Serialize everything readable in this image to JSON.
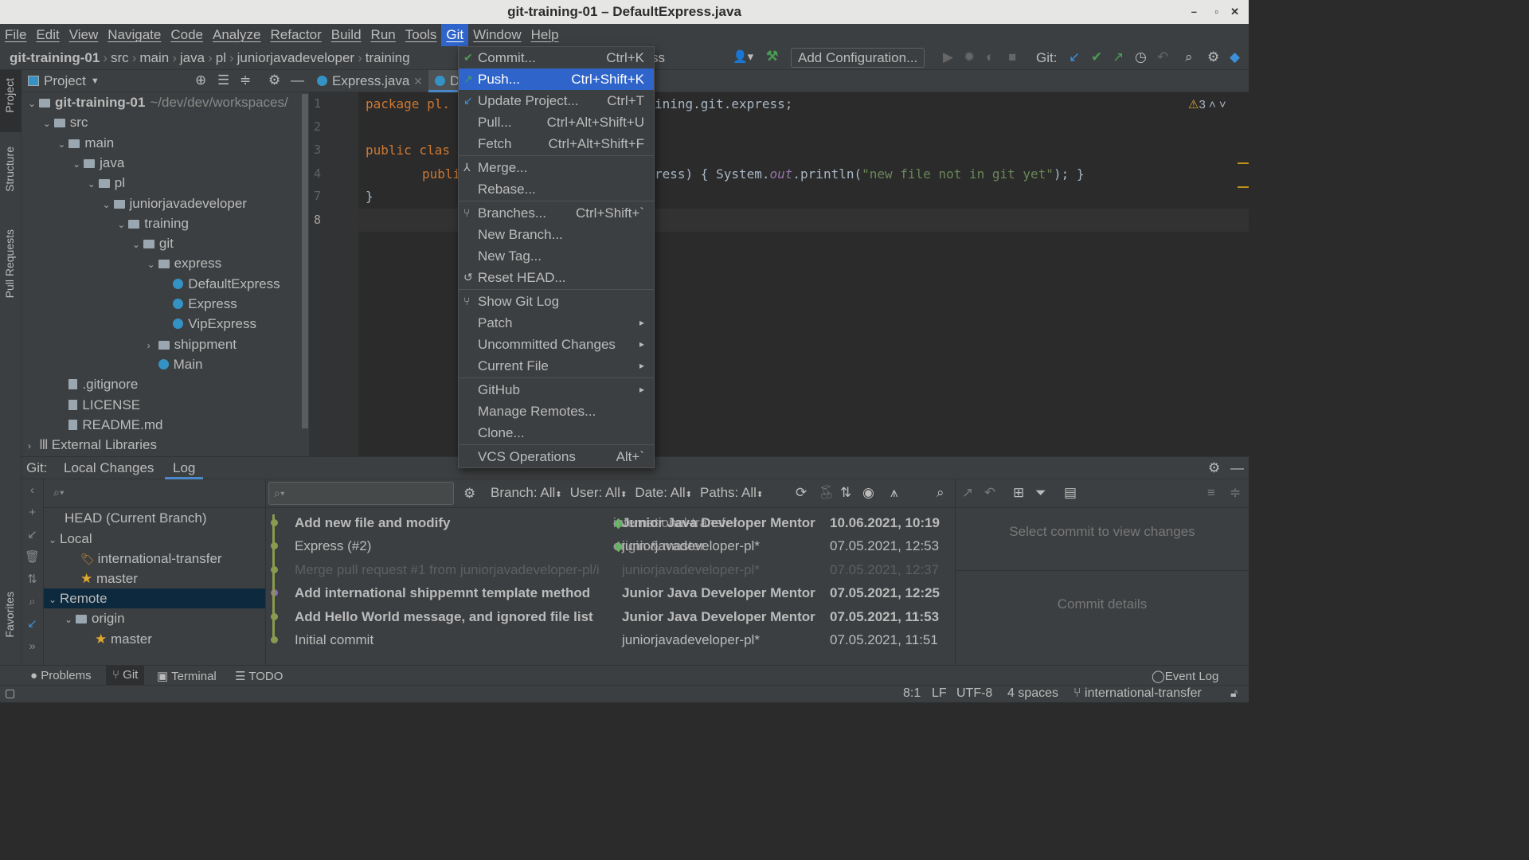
{
  "window": {
    "title": "git-training-01 – DefaultExpress.java",
    "controls": [
      "–",
      "▫",
      "✕"
    ]
  },
  "menu": [
    "File",
    "Edit",
    "View",
    "Navigate",
    "Code",
    "Analyze",
    "Refactor",
    "Build",
    "Run",
    "Tools",
    "Git",
    "Window",
    "Help"
  ],
  "breadcrumb": [
    "git-training-01",
    "src",
    "main",
    "java",
    "pl",
    "juniorjavadeveloper",
    "training"
  ],
  "toolbar": {
    "run_config": "Add Configuration...",
    "git_label": "Git:"
  },
  "project": {
    "title": "Project",
    "tree": [
      {
        "label": "git-training-01",
        "suffix": "~/dev/dev/workspaces/",
        "depth": 0,
        "type": "module",
        "open": true
      },
      {
        "label": "src",
        "depth": 1,
        "type": "folder",
        "open": true
      },
      {
        "label": "main",
        "depth": 2,
        "type": "folder",
        "open": true
      },
      {
        "label": "java",
        "depth": 3,
        "type": "folder",
        "open": true
      },
      {
        "label": "pl",
        "depth": 4,
        "type": "folder",
        "open": true
      },
      {
        "label": "juniorjavadeveloper",
        "depth": 5,
        "type": "folder",
        "open": true
      },
      {
        "label": "training",
        "depth": 6,
        "type": "folder",
        "open": true
      },
      {
        "label": "git",
        "depth": 7,
        "type": "folder",
        "open": true
      },
      {
        "label": "express",
        "depth": 8,
        "type": "folder",
        "open": true
      },
      {
        "label": "DefaultExpress",
        "depth": 9,
        "type": "class"
      },
      {
        "label": "Express",
        "depth": 9,
        "type": "class"
      },
      {
        "label": "VipExpress",
        "depth": 9,
        "type": "class"
      },
      {
        "label": "shippment",
        "depth": 8,
        "type": "folder",
        "open": false
      },
      {
        "label": "Main",
        "depth": 8,
        "type": "class"
      },
      {
        "label": ".gitignore",
        "depth": 2,
        "type": "file"
      },
      {
        "label": "LICENSE",
        "depth": 2,
        "type": "file"
      },
      {
        "label": "README.md",
        "depth": 2,
        "type": "file"
      },
      {
        "label": "External Libraries",
        "depth": 0,
        "type": "lib",
        "open": false
      }
    ]
  },
  "side_tools": [
    "Project",
    "Structure",
    "Pull Requests",
    "Favorites"
  ],
  "editor": {
    "tabs": [
      "Express.java",
      "D"
    ],
    "line_numbers": [
      "1",
      "2",
      "3",
      "4",
      "7",
      "8"
    ],
    "warnings": "3",
    "code": {
      "l1a": "package pl.",
      "l1b": "ining.git.express;",
      "l3a": "public clas",
      "l4a": "public",
      "l4b": "ress) { System.",
      "l4c": "out",
      "l4d": ".println(",
      "l4e": "\"new file not in git yet\"",
      "l4f": "); }",
      "l7": "}",
      "tail": "ss"
    }
  },
  "git_menu": [
    {
      "label": "Commit...",
      "shortcut": "Ctrl+K",
      "icon": "check-icon"
    },
    {
      "label": "Push...",
      "shortcut": "Ctrl+Shift+K",
      "icon": "push-arrow-icon",
      "selected": true
    },
    {
      "label": "Update Project...",
      "shortcut": "Ctrl+T",
      "icon": "update-arrow-icon"
    },
    {
      "label": "Pull...",
      "shortcut": "Ctrl+Alt+Shift+U"
    },
    {
      "label": "Fetch",
      "shortcut": "Ctrl+Alt+Shift+F",
      "sep_after": true
    },
    {
      "label": "Merge...",
      "icon": "merge-icon"
    },
    {
      "label": "Rebase...",
      "sep_after": true
    },
    {
      "label": "Branches...",
      "shortcut": "Ctrl+Shift+`",
      "icon": "branch-icon"
    },
    {
      "label": "New Branch..."
    },
    {
      "label": "New Tag..."
    },
    {
      "label": "Reset HEAD...",
      "icon": "reset-icon",
      "sep_after": true
    },
    {
      "label": "Show Git Log",
      "icon": "git-log-icon"
    },
    {
      "label": "Patch",
      "submenu": true
    },
    {
      "label": "Uncommitted Changes",
      "submenu": true
    },
    {
      "label": "Current File",
      "submenu": true,
      "sep_after": true
    },
    {
      "label": "GitHub",
      "submenu": true
    },
    {
      "label": "Manage Remotes..."
    },
    {
      "label": "Clone...",
      "sep_after": true
    },
    {
      "label": "VCS Operations",
      "shortcut": "Alt+`"
    }
  ],
  "git_panel": {
    "label": "Git:",
    "tabs": [
      "Local Changes",
      "Log"
    ],
    "active_tab": "Log",
    "filters": [
      "Branch: All",
      "User: All",
      "Date: All",
      "Paths: All"
    ],
    "branches": {
      "head": "HEAD (Current Branch)",
      "local": "Local",
      "local_items": [
        "international-transfer",
        "master"
      ],
      "remote": "Remote",
      "origin": "origin",
      "origin_items": [
        "master"
      ]
    },
    "commits": [
      {
        "message": "Add new file and modify",
        "tag": "international-transfer",
        "author": "Junior Java Developer Mentor",
        "date": "10.06.2021, 10:19",
        "bold": true
      },
      {
        "message": "Express (#2)",
        "tag": "origin & master",
        "author": "juniorjavadeveloper-pl*",
        "date": "07.05.2021, 12:53"
      },
      {
        "message": "Merge pull request #1 from juniorjavadeveloper-pl/i",
        "author": "juniorjavadeveloper-pl*",
        "date": "07.05.2021, 12:37",
        "dim": true
      },
      {
        "message": "Add international shippemnt template method",
        "author": "Junior Java Developer Mentor",
        "date": "07.05.2021, 12:25",
        "bold": true
      },
      {
        "message": "Add Hello World message, and ignored file list",
        "author": "Junior Java Developer Mentor",
        "date": "07.05.2021, 11:53",
        "bold": true
      },
      {
        "message": "Initial commit",
        "author": "juniorjavadeveloper-pl*",
        "date": "07.05.2021, 11:51"
      }
    ],
    "changes_placeholder": "Select commit to view changes",
    "details_placeholder": "Commit details"
  },
  "bottom_tabs": [
    "Problems",
    "Git",
    "Terminal",
    "TODO"
  ],
  "event_log": "Event Log",
  "status": {
    "position": "8:1",
    "line_sep": "LF",
    "encoding": "UTF-8",
    "indent": "4 spaces",
    "branch": "international-transfer"
  },
  "colors": {
    "accent": "#2f65ca",
    "background": "#2b2b2b",
    "panel": "#3c3f41"
  }
}
